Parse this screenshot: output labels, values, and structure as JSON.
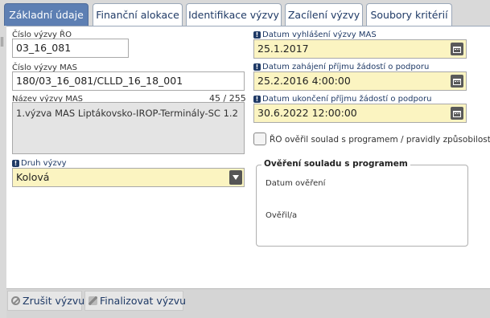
{
  "tabs": [
    {
      "label": "Základní údaje",
      "active": true
    },
    {
      "label": "Finanční alokace",
      "active": false
    },
    {
      "label": "Identifikace výzvy",
      "active": false
    },
    {
      "label": "Zacílení výzvy",
      "active": false
    },
    {
      "label": "Soubory kritérií",
      "active": false
    }
  ],
  "form": {
    "cislo_ro": {
      "label": "Číslo výzvy ŘO",
      "value": "03_16_081"
    },
    "cislo_mas": {
      "label": "Číslo výzvy MAS",
      "value": "180/03_16_081/CLLD_16_18_001"
    },
    "nazev_mas": {
      "label": "Název výzvy MAS",
      "counter": "45 / 255",
      "value": "1.výzva MAS Liptákovsko-IROP-Terminály-SC 1.2"
    },
    "druh": {
      "label": "Druh výzvy",
      "value": "Kolová"
    },
    "datum_vyhlaseni": {
      "label": "Datum vyhlášení výzvy MAS",
      "value": "25.1.2017"
    },
    "datum_zahajeni": {
      "label": "Datum zahájení příjmu žádostí o podporu",
      "value": "25.2.2016 4:00:00"
    },
    "datum_ukonceni": {
      "label": "Datum ukončení příjmu žádostí o podporu",
      "value": "30.6.2022 12:00:00"
    },
    "ro_overil": {
      "label": "ŘO ověřil soulad s programem / pravidly způsobilosti",
      "checked": false
    },
    "overeni": {
      "title": "Ověření souladu s programem",
      "datum_label": "Datum ověření",
      "overil_label": "Ověřil/a"
    }
  },
  "required_marker": "!",
  "footer": {
    "zrusit": "Zrušit výzvu",
    "finalizovat": "Finalizovat výzvu"
  },
  "colors": {
    "tab_active": "#5d7fb3",
    "required_field": "#fbf4c1",
    "label_blue": "#1f3a66"
  }
}
